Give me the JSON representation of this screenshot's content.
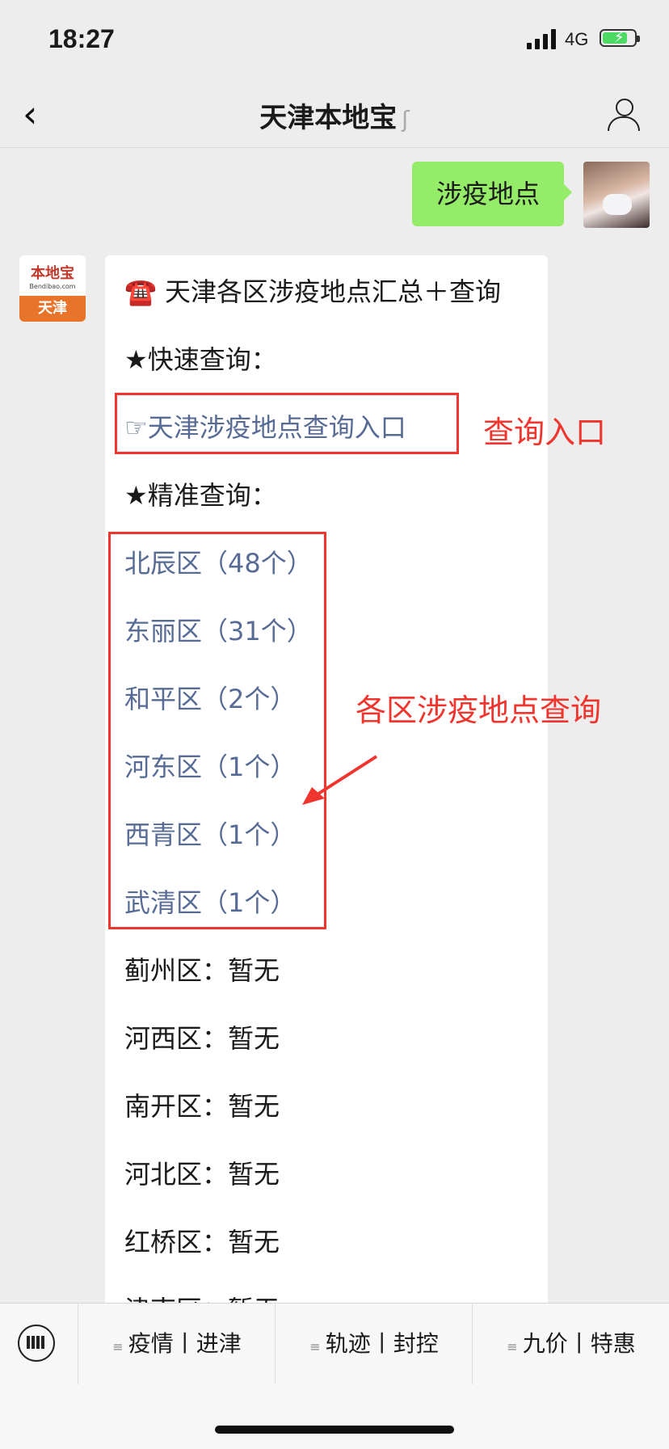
{
  "status": {
    "time": "18:27",
    "network": "4G"
  },
  "nav": {
    "title": "天津本地宝",
    "ear_icon": "ear-icon"
  },
  "chat": {
    "my_message": "涉疫地点",
    "bot_avatar": {
      "brand": "本地宝",
      "domain": "Bendibao.com",
      "city": "天津"
    },
    "headline_icon": "☎️",
    "headline": "天津各区涉疫地点汇总＋查询",
    "quick_label": "★快速查询：",
    "quick_link": "☞天津涉疫地点查询入口",
    "precise_label": "★精准查询：",
    "district_links": [
      "北辰区（48个）",
      "东丽区（31个）",
      "和平区（2个）",
      "河东区（1个）",
      "西青区（1个）",
      "武清区（1个）"
    ],
    "district_none": [
      "蓟州区：暂无",
      "河西区：暂无",
      "南开区：暂无",
      "河北区：暂无",
      "红桥区：暂无"
    ],
    "cut_off_line": "津南区：暂无"
  },
  "annotations": {
    "entry_label": "查询入口",
    "district_label": "各区涉疫地点查询"
  },
  "bottom_menu": [
    "疫情丨进津",
    "轨迹丨封控",
    "九价丨特惠"
  ],
  "colors": {
    "link": "#576b95",
    "bubble": "#95ec69",
    "annotation_red": "#f0342e"
  }
}
